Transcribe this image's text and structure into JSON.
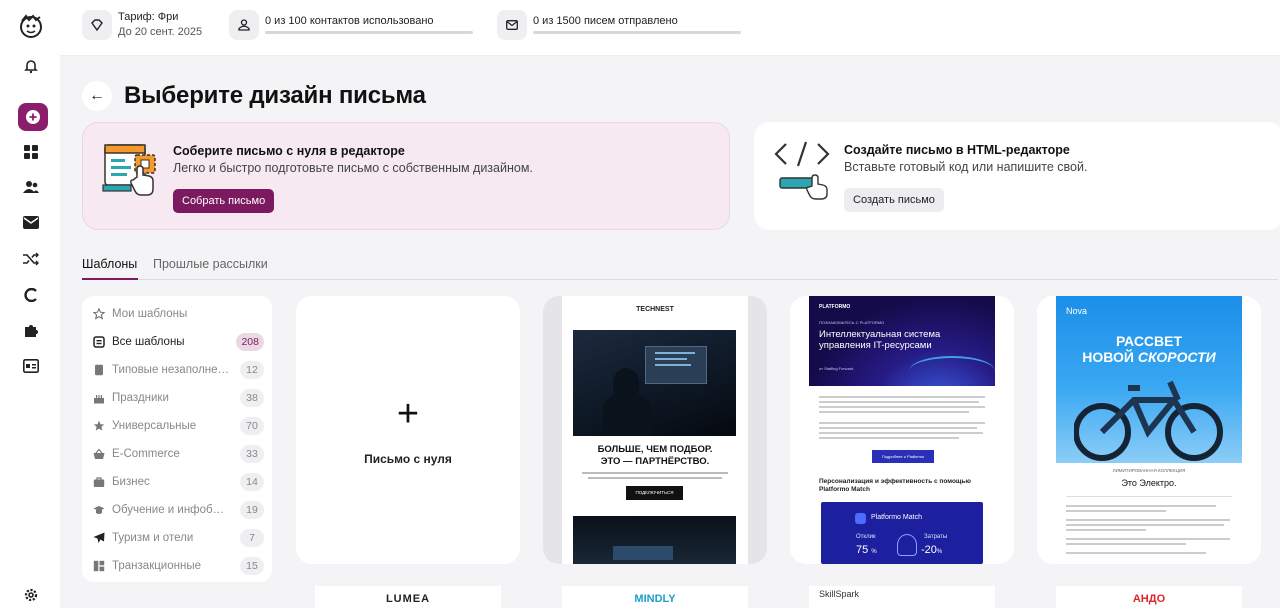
{
  "topbar": {
    "tariff_title": "Тариф: Фри",
    "tariff_sub": "До 20 сент. 2025",
    "contacts": "0 из 100 контактов использовано",
    "contacts_used_fraction": 0,
    "emails": "0 из 1500 писем отправлено",
    "emails_sent_fraction": 0
  },
  "page": {
    "title": "Выберите дизайн письма"
  },
  "builder_card": {
    "title": "Соберите письмо с нуля в редакторе",
    "desc": "Легко и быстро подготовьте письмо с собственным дизайном.",
    "button": "Собрать письмо"
  },
  "html_card": {
    "title": "Создайте письмо в HTML-редакторе",
    "desc": "Вставьте готовый код или напишите свой.",
    "button": "Создать письмо"
  },
  "tabs": [
    "Шаблоны",
    "Прошлые рассылки"
  ],
  "categories": [
    {
      "label": "Мои шаблоны",
      "count": "",
      "icon": "star-outline-icon"
    },
    {
      "label": "Все шаблоны",
      "count": "208",
      "icon": "copy-icon"
    },
    {
      "label": "Типовые незаполнен…",
      "count": "12",
      "icon": "document-icon"
    },
    {
      "label": "Праздники",
      "count": "38",
      "icon": "cake-icon"
    },
    {
      "label": "Универсальные",
      "count": "70",
      "icon": "star-icon"
    },
    {
      "label": "E-Commerce",
      "count": "33",
      "icon": "basket-icon"
    },
    {
      "label": "Бизнес",
      "count": "14",
      "icon": "briefcase-icon"
    },
    {
      "label": "Обучение и инфобиз…",
      "count": "19",
      "icon": "graduation-cap-icon"
    },
    {
      "label": "Туризм и отели",
      "count": "7",
      "icon": "airplane-icon"
    },
    {
      "label": "Транзакционные",
      "count": "15",
      "icon": "layout-icon"
    }
  ],
  "blank_tile": {
    "label": "Письмо с нуля"
  },
  "templates": {
    "technest": {
      "logo": "TECHNEST",
      "headline": "БОЛЬШЕ, ЧЕМ ПОДБОР.\nЭТО — ПАРТНЁРСТВО.",
      "button": "ПОДКЛЮЧИТЬСЯ"
    },
    "platformo": {
      "logo": "PLATFORMO",
      "kicker": "ПОЗНАКОМЬТЕСЬ С PLATFORMO",
      "headline": "Интеллектуальная система управления IT-ресурсами",
      "sub": "от Staffing Forward",
      "button": "Подробнее о Platformo",
      "section": "Персонализация и эффективность с помощью Platformo Match",
      "match_title": "Platformo Match",
      "stat1_label": "Отклик",
      "stat1_value": "75",
      "stat1_unit": "%",
      "stat2_label": "Затраты",
      "stat2_value": "-20",
      "stat2_unit": "%"
    },
    "nova": {
      "logo": "Nova",
      "headline1": "РАССВЕТ",
      "headline2a": "НОВОЙ ",
      "headline2b": "СКОРОСТИ",
      "kicker": "ЛИМИТИРОВАННАЯ КОЛЛЕКЦИЯ",
      "title": "Это Электро."
    }
  },
  "bottom_row": [
    "LUMEA",
    "MINDLY",
    "SkillSpark",
    "АНДО"
  ],
  "colors": {
    "brand": "#7b1a5e",
    "builder_bg": "#f6e9f2"
  }
}
